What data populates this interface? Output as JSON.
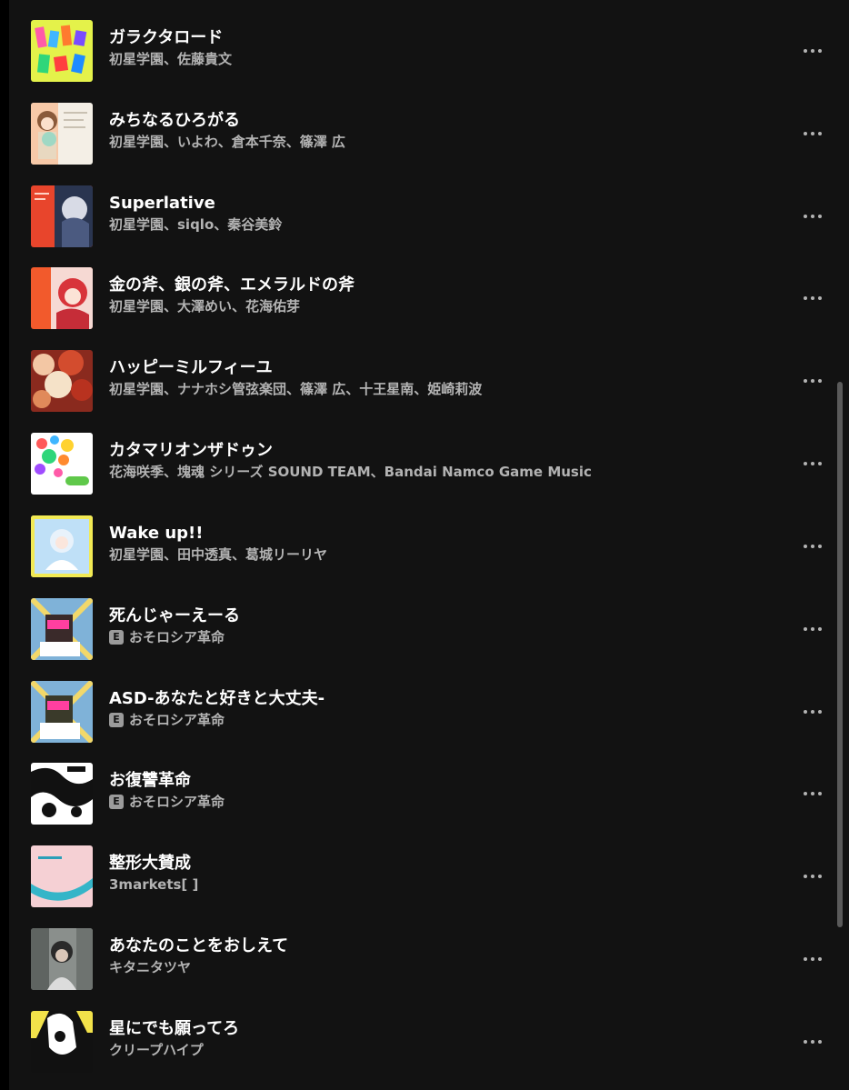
{
  "tracks": [
    {
      "title": "ガラクタロード",
      "artists": "初星学園、佐藤貴文",
      "explicit": false
    },
    {
      "title": "みちなるひろがる",
      "artists": "初星学園、いよわ、倉本千奈、篠澤 広",
      "explicit": false
    },
    {
      "title": "Superlative",
      "artists": "初星学園、siqlo、秦谷美鈴",
      "explicit": false
    },
    {
      "title": "金の斧、銀の斧、エメラルドの斧",
      "artists": "初星学園、大澤めい、花海佑芽",
      "explicit": false
    },
    {
      "title": "ハッピーミルフィーユ",
      "artists": "初星学園、ナナホシ管弦楽団、篠澤 広、十王星南、姫崎莉波",
      "explicit": false
    },
    {
      "title": "カタマリオンザドゥン",
      "artists": "花海咲季、塊魂 シリーズ SOUND TEAM、Bandai Namco Game Music",
      "explicit": false
    },
    {
      "title": "Wake up!!",
      "artists": "初星学園、田中透真、葛城リーリヤ",
      "explicit": false
    },
    {
      "title": "死んじゃーえーる",
      "artists": "おそロシア革命",
      "explicit": true
    },
    {
      "title": "ASD-あなたと好きと大丈夫-",
      "artists": "おそロシア革命",
      "explicit": true
    },
    {
      "title": "お復讐革命",
      "artists": "おそロシア革命",
      "explicit": true
    },
    {
      "title": "整形大賛成",
      "artists": "3markets[ ]",
      "explicit": false
    },
    {
      "title": "あなたのことをおしえて",
      "artists": "キタニタツヤ",
      "explicit": false
    },
    {
      "title": "星にでも願ってろ",
      "artists": "クリープハイプ",
      "explicit": false
    }
  ],
  "explicit_badge": "E",
  "colors": {
    "background": "#121212",
    "title": "#ffffff",
    "subtitle": "#b3b3b3",
    "badge": "#9b9b9b"
  },
  "icons": {
    "more_options": "more-options-icon"
  }
}
